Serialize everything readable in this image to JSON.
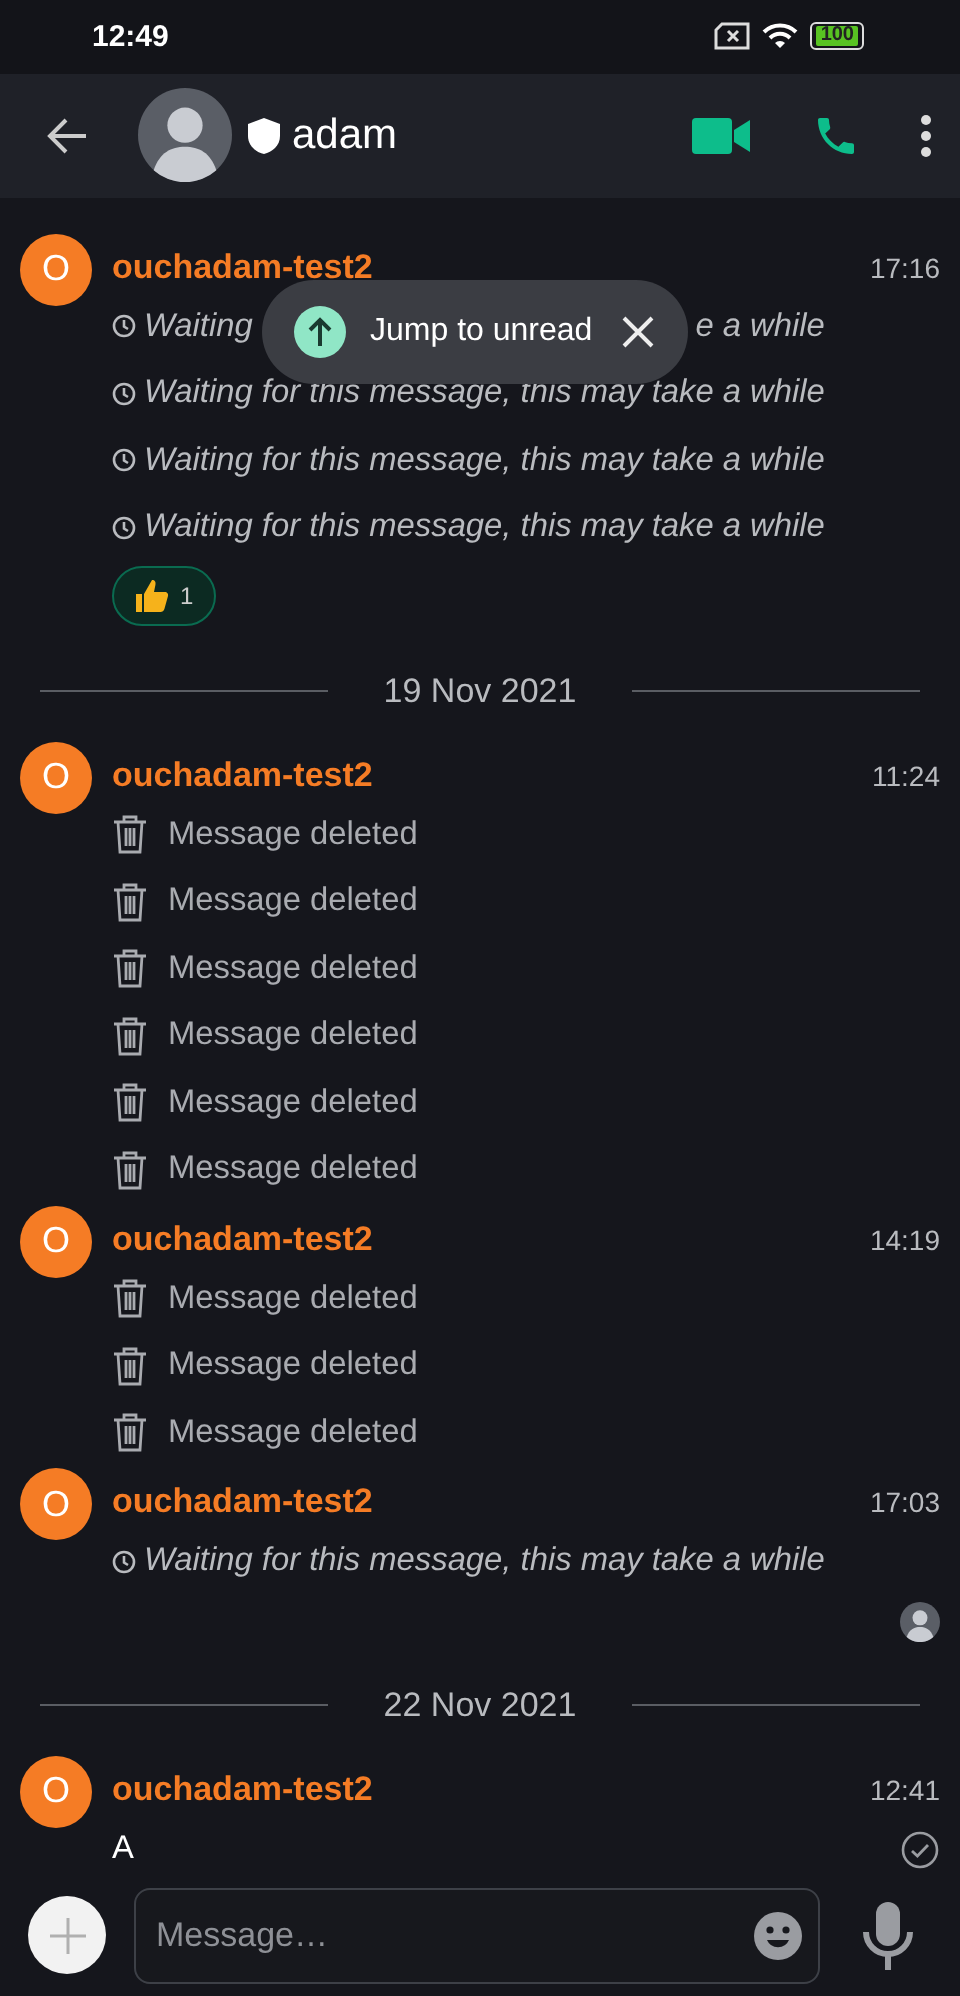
{
  "status_bar": {
    "time": "12:49",
    "battery": "100"
  },
  "header": {
    "title": "adam",
    "verified": true
  },
  "toast": {
    "label": "Jump to unread"
  },
  "timeline": [
    {
      "kind": "group",
      "avatar_letter": "O",
      "sender": "ouchadam-test2",
      "time": "17:16",
      "lines": [
        {
          "kind": "covered",
          "text": "Waiting",
          "tail": "e a while"
        },
        {
          "kind": "waiting",
          "text": "Waiting for this message, this may take a while"
        },
        {
          "kind": "waiting",
          "text": "Waiting for this message, this may take a while"
        },
        {
          "kind": "waiting",
          "text": "Waiting for this message, this may take a while"
        }
      ],
      "reactions": [
        {
          "count": "1",
          "selected": true
        }
      ],
      "read_by_avatar": false,
      "sent": false
    },
    {
      "kind": "date",
      "label": "19 Nov 2021"
    },
    {
      "kind": "group",
      "avatar_letter": "O",
      "sender": "ouchadam-test2",
      "time": "11:24",
      "lines": [
        {
          "kind": "deleted",
          "text": "Message deleted"
        },
        {
          "kind": "deleted",
          "text": "Message deleted"
        },
        {
          "kind": "deleted",
          "text": "Message deleted"
        },
        {
          "kind": "deleted",
          "text": "Message deleted"
        },
        {
          "kind": "deleted",
          "text": "Message deleted"
        },
        {
          "kind": "deleted",
          "text": "Message deleted"
        }
      ],
      "read_by_avatar": false,
      "sent": false
    },
    {
      "kind": "group",
      "avatar_letter": "O",
      "sender": "ouchadam-test2",
      "time": "14:19",
      "lines": [
        {
          "kind": "deleted",
          "text": "Message deleted"
        },
        {
          "kind": "deleted",
          "text": "Message deleted"
        },
        {
          "kind": "deleted",
          "text": "Message deleted"
        }
      ],
      "read_by_avatar": false,
      "sent": false
    },
    {
      "kind": "group",
      "avatar_letter": "O",
      "sender": "ouchadam-test2",
      "time": "17:03",
      "lines": [
        {
          "kind": "waiting",
          "text": "Waiting for this message, this may take a while"
        }
      ],
      "read_by_avatar": true,
      "sent": false
    },
    {
      "kind": "date",
      "label": "22 Nov 2021"
    },
    {
      "kind": "group",
      "avatar_letter": "O",
      "sender": "ouchadam-test2",
      "time": "12:41",
      "lines": [
        {
          "kind": "text",
          "text": "A"
        }
      ],
      "read_by_avatar": false,
      "sent": true
    }
  ],
  "composer": {
    "placeholder": "Message…"
  }
}
